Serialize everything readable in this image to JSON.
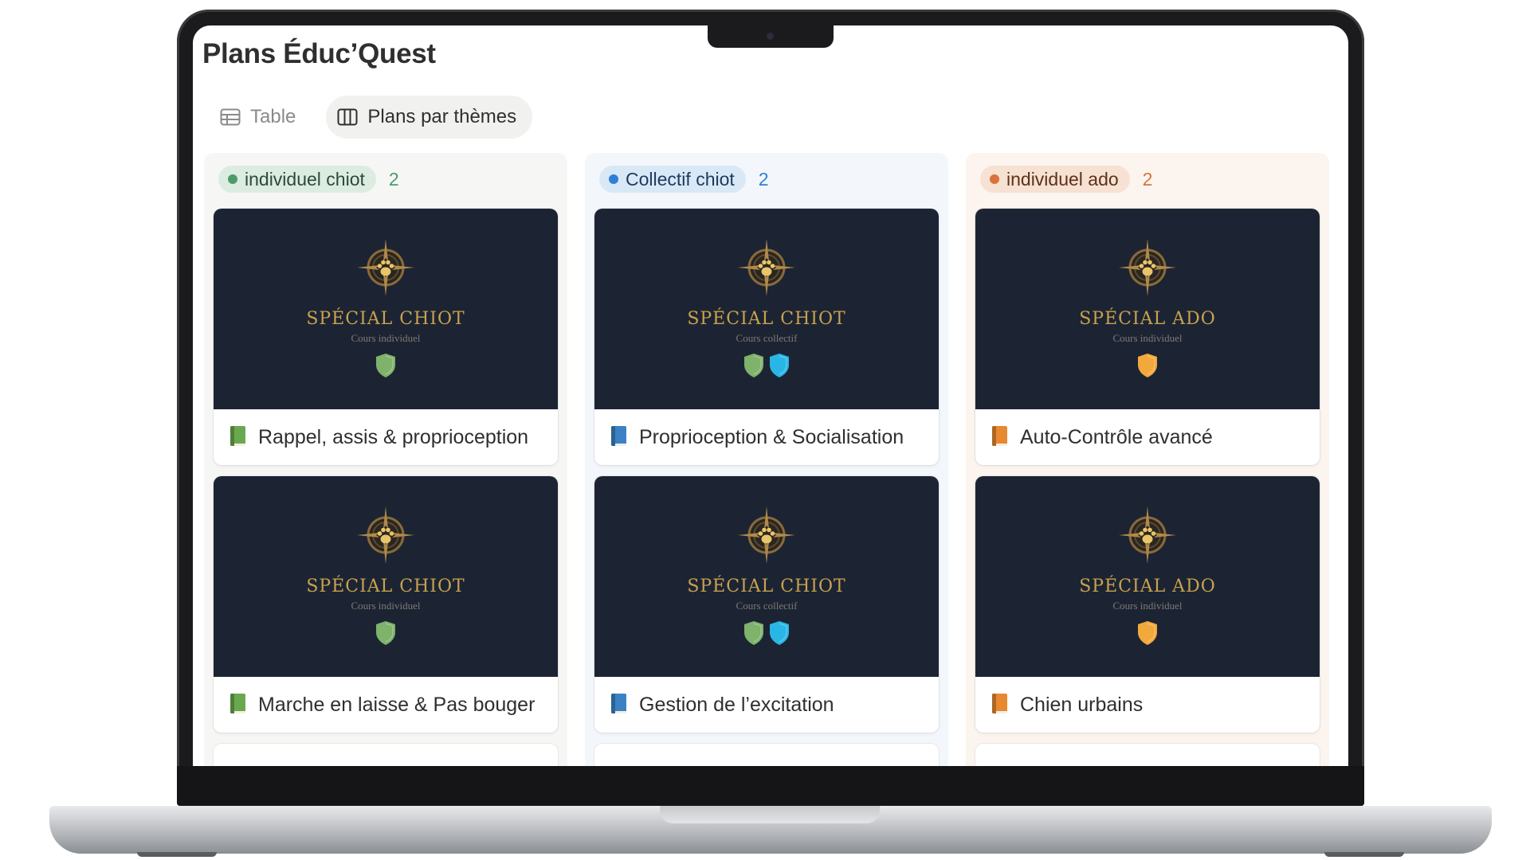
{
  "page": {
    "title": "Plans Éduc’Quest"
  },
  "views": [
    {
      "label": "Table",
      "icon": "table-icon",
      "active": false
    },
    {
      "label": "Plans par thèmes",
      "icon": "board-icon",
      "active": true
    }
  ],
  "columns": [
    {
      "label": "individuel chiot",
      "count": "2",
      "color": "#4b9b6a",
      "cards": [
        {
          "cover_title": "SPÉCIAL CHIOT",
          "cover_subtitle": "Cours individuel",
          "shields": [
            "#7fb26a"
          ],
          "book_color": "#6aa84f",
          "title": "Rappel, assis & proprioception"
        },
        {
          "cover_title": "SPÉCIAL CHIOT",
          "cover_subtitle": "Cours individuel",
          "shields": [
            "#7fb26a"
          ],
          "book_color": "#6aa84f",
          "title": "Marche en laisse & Pas bouger"
        }
      ]
    },
    {
      "label": "Collectif chiot",
      "count": "2",
      "color": "#2e7fd8",
      "cards": [
        {
          "cover_title": "SPÉCIAL CHIOT",
          "cover_subtitle": "Cours collectif",
          "shields": [
            "#7fb26a",
            "#29b6e6"
          ],
          "book_color": "#3b82c4",
          "title": "Proprioception & Socialisation"
        },
        {
          "cover_title": "SPÉCIAL CHIOT",
          "cover_subtitle": "Cours collectif",
          "shields": [
            "#7fb26a",
            "#29b6e6"
          ],
          "book_color": "#3b82c4",
          "title": "Gestion de l’excitation"
        }
      ]
    },
    {
      "label": "individuel ado",
      "count": "2",
      "color": "#d9733a",
      "cards": [
        {
          "cover_title": "SPÉCIAL ADO",
          "cover_subtitle": "Cours individuel",
          "shields": [
            "#f2a93b"
          ],
          "book_color": "#e8892f",
          "title": "Auto-Contrôle avancé"
        },
        {
          "cover_title": "SPÉCIAL ADO",
          "cover_subtitle": "Cours individuel",
          "shields": [
            "#f2a93b"
          ],
          "book_color": "#e8892f",
          "title": "Chien urbains"
        }
      ]
    }
  ]
}
